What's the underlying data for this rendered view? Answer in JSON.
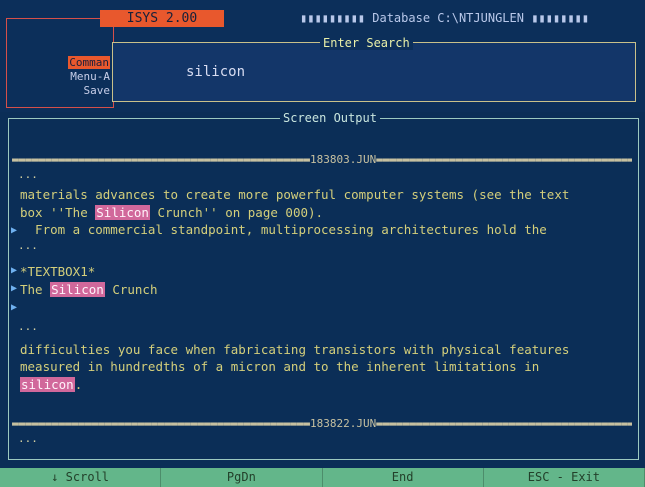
{
  "app": {
    "title": "ISYS 2.00",
    "database": "Database C:\\NTJUNGLEN"
  },
  "side_menu": {
    "commands": "Comman",
    "menu": "Menu-A",
    "save": "Save"
  },
  "search": {
    "title": "Enter Search",
    "query": "silicon"
  },
  "screen": {
    "title": "Screen Output",
    "separators": [
      "183803.JUN",
      "183822.JUN"
    ],
    "lines": {
      "l1": "materials advances to create more powerful computer systems (see the text",
      "l2_pre": "box ''The ",
      "l2_hl": "Silicon",
      "l2_post": " Crunch'' on page 000).",
      "l3": "  From a commercial standpoint, multiprocessing architectures hold the",
      "l4": "*TEXTBOX1*",
      "l5_pre": "The ",
      "l5_hl": "Silicon",
      "l5_post": " Crunch",
      "l6": "difficulties you face when fabricating transistors with physical features",
      "l7": "measured in hundredths of a micron and to the inherent limitations in",
      "l8_hl": "silicon",
      "l8_post": "."
    }
  },
  "statusbar": {
    "scroll": "↓ Scroll",
    "pgdn": "PgDn",
    "end": "End",
    "esc": "ESC - Exit"
  },
  "colors": {
    "brand": "#e8582d",
    "highlight": "#d1689b",
    "statusbar": "#63b68a",
    "text": "#d4cf7b"
  }
}
